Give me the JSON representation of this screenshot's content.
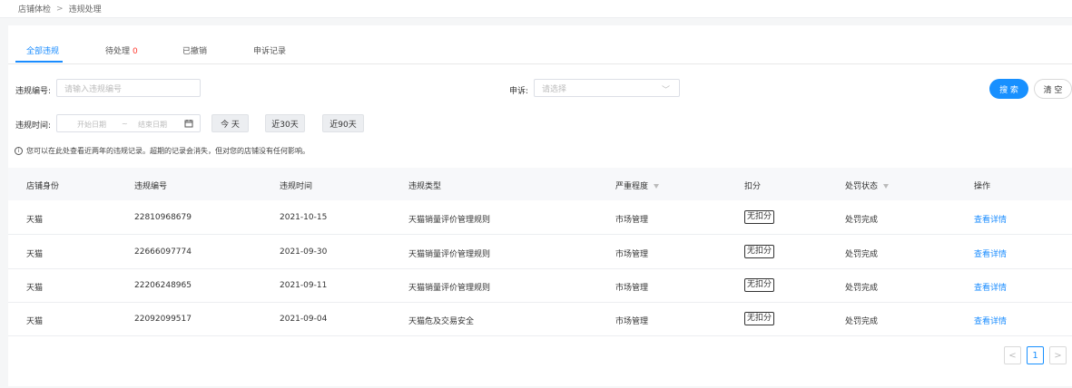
{
  "breadcrumb": {
    "root": "店铺体检",
    "sep": ">",
    "current": "违规处理"
  },
  "tabs": [
    {
      "label": "全部违规",
      "active": true
    },
    {
      "label": "待处理",
      "count": "0"
    },
    {
      "label": "已撤销"
    },
    {
      "label": "申诉记录"
    }
  ],
  "filters": {
    "id_label": "违规编号:",
    "id_placeholder": "请输入违规编号",
    "appeal_label": "申诉:",
    "appeal_placeholder": "请选择",
    "time_label": "违规时间:",
    "start_placeholder": "开始日期",
    "range_sep": "~",
    "end_placeholder": "结束日期",
    "quick": [
      "今 天",
      "近30天",
      "近90天"
    ],
    "search_label": "搜 索",
    "clear_label": "清 空"
  },
  "notice": "您可以在此处查看近两年的违规记录。超期的记录会消失，但对您的店铺没有任何影响。",
  "table": {
    "headers": [
      "店铺身份",
      "违规编号",
      "违规时间",
      "违规类型",
      "严重程度",
      "扣分",
      "处罚状态",
      "操作"
    ],
    "rows": [
      {
        "shop": "天猫",
        "id": "22810968679",
        "time": "2021-10-15",
        "type": "天猫销量评价管理规则",
        "severity": "市场管理",
        "deduct": "无扣分",
        "status": "处罚完成",
        "action": "查看详情"
      },
      {
        "shop": "天猫",
        "id": "22666097774",
        "time": "2021-09-30",
        "type": "天猫销量评价管理规则",
        "severity": "市场管理",
        "deduct": "无扣分",
        "status": "处罚完成",
        "action": "查看详情"
      },
      {
        "shop": "天猫",
        "id": "22206248965",
        "time": "2021-09-11",
        "type": "天猫销量评价管理规则",
        "severity": "市场管理",
        "deduct": "无扣分",
        "status": "处罚完成",
        "action": "查看详情"
      },
      {
        "shop": "天猫",
        "id": "22092099517",
        "time": "2021-09-04",
        "type": "天猫危及交易安全",
        "severity": "市场管理",
        "deduct": "无扣分",
        "status": "处罚完成",
        "action": "查看详情"
      }
    ]
  },
  "pagination": {
    "prev": "<",
    "current": "1",
    "next": ">"
  },
  "colors": {
    "accent": "#1890ff",
    "badge": "#ff3b30"
  }
}
